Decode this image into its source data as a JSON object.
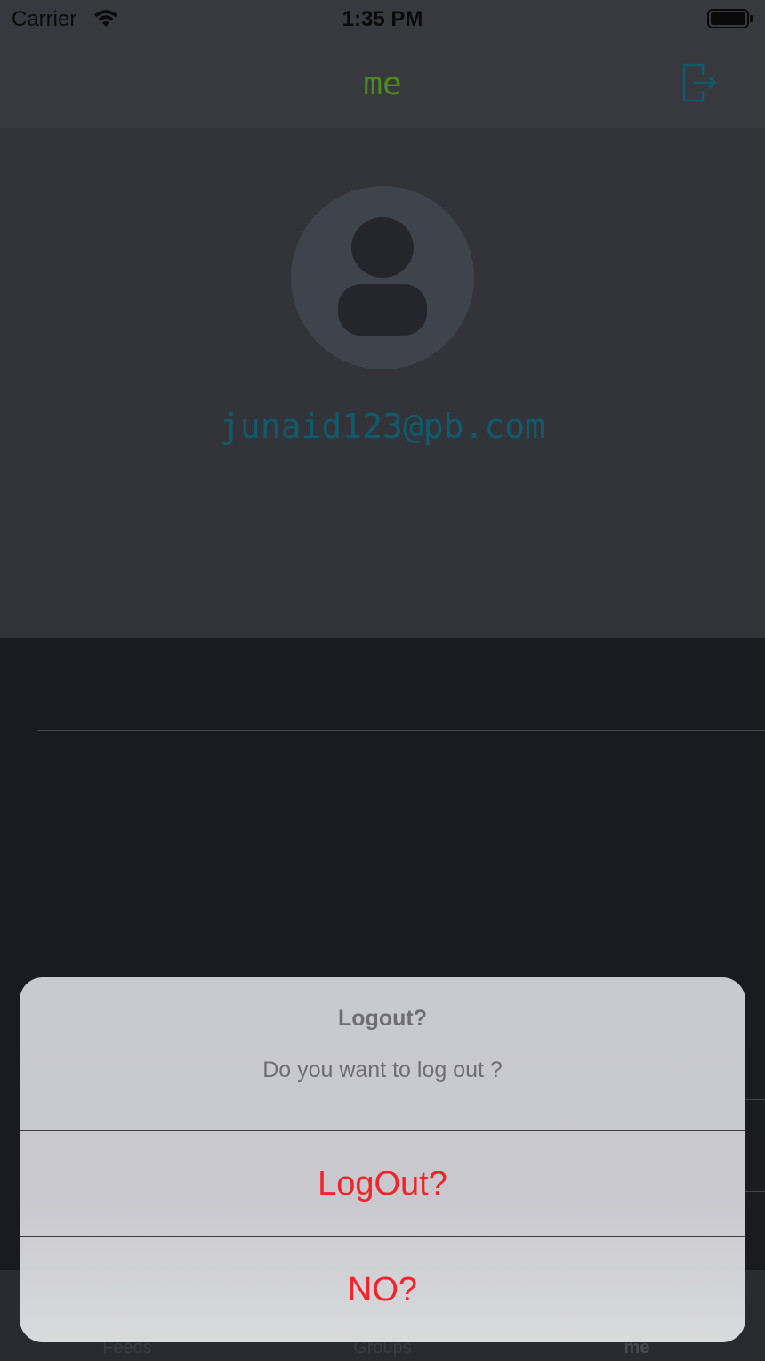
{
  "status_bar": {
    "carrier": "Carrier",
    "time": "1:35 PM",
    "wifi_icon": "wifi-icon",
    "battery_icon": "battery-icon"
  },
  "nav": {
    "title": "me",
    "title_color": "#4e8a1e",
    "logout_icon": "logout-icon",
    "icon_color": "#0f5a6c"
  },
  "profile": {
    "avatar_icon": "person-icon",
    "email": "junaid123@pb.com",
    "email_color": "#0f5a6c"
  },
  "tabs": [
    {
      "label": "Feeds"
    },
    {
      "label": "Groups"
    },
    {
      "label": "me",
      "active": true
    }
  ],
  "alert": {
    "title": "Logout?",
    "message": "Do you want to log out ?",
    "confirm_label": "LogOut?",
    "cancel_label": "NO?",
    "button_color": "#f2242a"
  }
}
